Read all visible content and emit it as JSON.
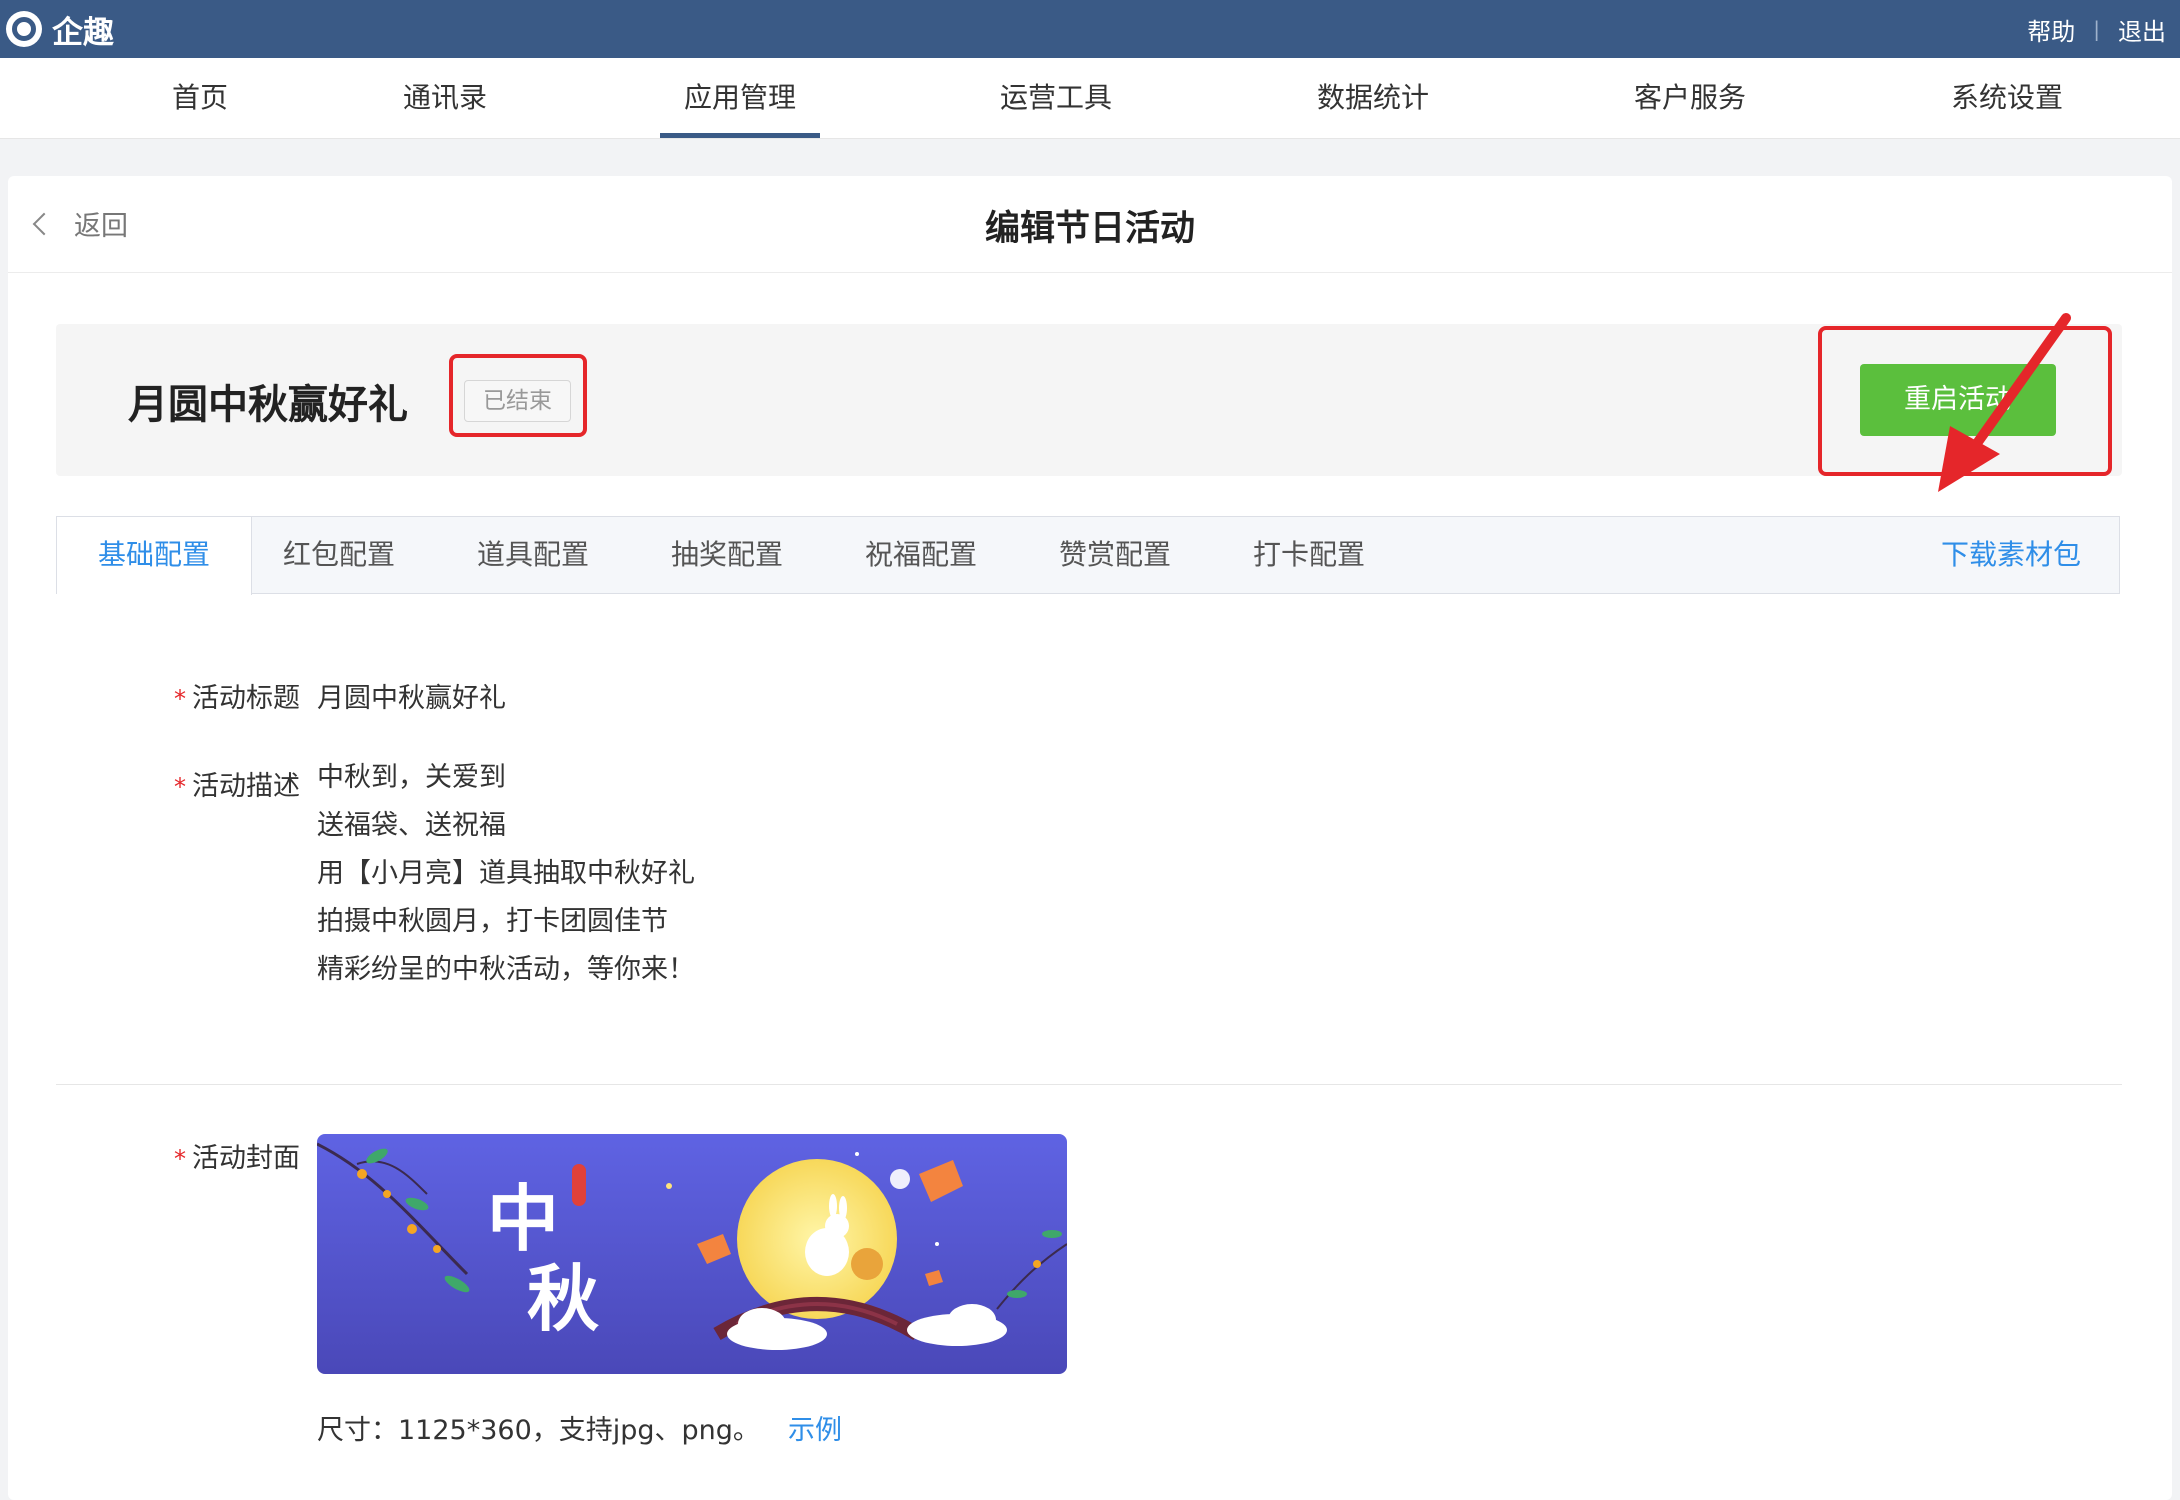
{
  "topbar": {
    "logo_text": "企趣",
    "help_label": "帮助",
    "separator": "|",
    "logout_label": "退出"
  },
  "nav": {
    "items": [
      {
        "label": "首页"
      },
      {
        "label": "通讯录"
      },
      {
        "label": "应用管理",
        "active": true
      },
      {
        "label": "运营工具"
      },
      {
        "label": "数据统计"
      },
      {
        "label": "客户服务"
      },
      {
        "label": "系统设置"
      }
    ]
  },
  "header": {
    "back_label": "返回",
    "title": "编辑节日活动"
  },
  "activity": {
    "name": "月圆中秋赢好礼",
    "status": "已结束",
    "restart_label": "重启活动"
  },
  "tabs": {
    "items": [
      "基础配置",
      "红包配置",
      "道具配置",
      "抽奖配置",
      "祝福配置",
      "赞赏配置",
      "打卡配置"
    ],
    "active": "基础配置",
    "download_label": "下载素材包"
  },
  "form": {
    "title_label": "活动标题",
    "title_value": "月圆中秋赢好礼",
    "desc_label": "活动描述",
    "desc_lines": [
      "中秋到，关爱到",
      "送福袋、送祝福",
      "用【小月亮】道具抽取中秋好礼",
      "拍摄中秋圆月，打卡团圆佳节",
      "精彩纷呈的中秋活动，等你来！"
    ],
    "cover_label": "活动封面",
    "cover_text_1": "中",
    "cover_text_2": "秋",
    "size_note": "尺寸：1125*360，支持jpg、png。",
    "example_label": "示例",
    "required_mark": "*"
  },
  "colors": {
    "topbar": "#3a5a86",
    "accent": "#2f8ee8",
    "primary_button": "#5bbf3d",
    "highlight": "#e5262a"
  }
}
